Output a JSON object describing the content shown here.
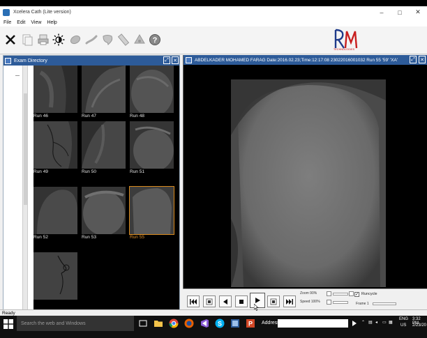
{
  "window": {
    "title": "Xcelera Cath (Lite version)",
    "controls": [
      "–",
      "□",
      "✕"
    ]
  },
  "menu": [
    "File",
    "Edit",
    "View",
    "Help"
  ],
  "toolbar_icons": [
    "close-tool-icon",
    "copy-icon",
    "print-icon",
    "contrast-icon",
    "stroke-tool-icon",
    "measure-icon",
    "annotate-icon",
    "ruler-icon",
    "filter-icon",
    "help-icon"
  ],
  "logo": {
    "letters": "RM",
    "subtitle": "TECHNOLOGIES"
  },
  "exam_directory": {
    "title": "Exam Directory",
    "thumbnails": [
      {
        "label": "Run 46",
        "selected": false
      },
      {
        "label": "Run 47",
        "selected": false
      },
      {
        "label": "Run 48",
        "selected": false
      },
      {
        "label": "Run 49",
        "selected": false
      },
      {
        "label": "Run 50",
        "selected": false
      },
      {
        "label": "Run 51",
        "selected": false
      },
      {
        "label": "Run 52",
        "selected": false
      },
      {
        "label": "Run 53",
        "selected": false
      },
      {
        "label": "Run 55",
        "selected": true
      },
      {
        "label": "",
        "selected": false
      }
    ]
  },
  "viewer": {
    "header": "ABDELKADER  MOHAMED FARAG Date:2016.02.23;Time:12:17:08 23022016001032  Run 55 '59' 'XA'"
  },
  "playback": {
    "zoom_label": "Zoom 90%",
    "speed_label": "Speed 100%",
    "run_cycle_label": "Runcycle",
    "frame_label": "Frame 1",
    "run_cycle_checked": true
  },
  "status": {
    "text": "Ready"
  },
  "taskbar": {
    "search_placeholder": "Search the web and Windows",
    "address_label": "Address",
    "tray_lang": "ENG",
    "tray_region": "US",
    "clock_time": "3:32 PM",
    "clock_date": "2/23/20"
  }
}
